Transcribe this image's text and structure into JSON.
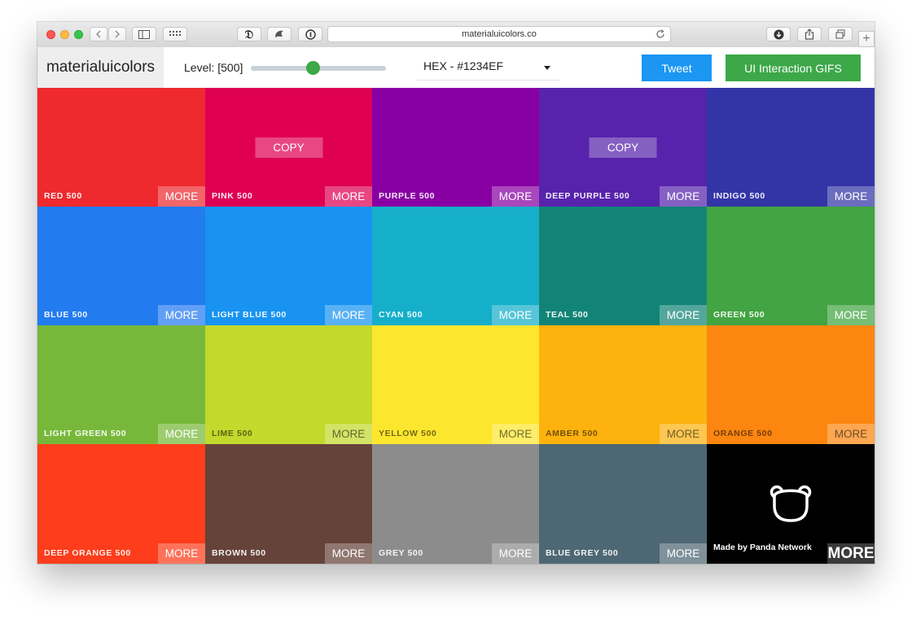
{
  "browser": {
    "url": "materialuicolors.co"
  },
  "header": {
    "logo": "materialuicolors",
    "level_label": "Level: [500]",
    "level_value": 500,
    "format_select": "HEX - #1234EF",
    "tweet_label": "Tweet",
    "gifs_label": "UI Interaction GIFS"
  },
  "actions": {
    "copy_label": "COPY",
    "more_label": "MORE"
  },
  "colors": [
    {
      "name": "RED 500",
      "hex": "#EE2A2E",
      "dark_text": false
    },
    {
      "name": "PINK 500",
      "hex": "#DF0054",
      "dark_text": false
    },
    {
      "name": "PURPLE 500",
      "hex": "#8800A3",
      "dark_text": false
    },
    {
      "name": "DEEP PURPLE 500",
      "hex": "#5723AC",
      "dark_text": false
    },
    {
      "name": "INDIGO 500",
      "hex": "#3335A7",
      "dark_text": false
    },
    {
      "name": "BLUE 500",
      "hex": "#237BF0",
      "dark_text": false
    },
    {
      "name": "LIGHT BLUE 500",
      "hex": "#1893F1",
      "dark_text": false
    },
    {
      "name": "CYAN 500",
      "hex": "#15AFCA",
      "dark_text": false
    },
    {
      "name": "TEAL 500",
      "hex": "#128477",
      "dark_text": false
    },
    {
      "name": "GREEN 500",
      "hex": "#42A442",
      "dark_text": false
    },
    {
      "name": "LIGHT GREEN 500",
      "hex": "#77B83A",
      "dark_text": false
    },
    {
      "name": "LIME 500",
      "hex": "#C3D92C",
      "dark_text": true
    },
    {
      "name": "YELLOW 500",
      "hex": "#FDE72E",
      "dark_text": true
    },
    {
      "name": "AMBER 500",
      "hex": "#FDB20E",
      "dark_text": true
    },
    {
      "name": "ORANGE 500",
      "hex": "#FC8610",
      "dark_text": true
    },
    {
      "name": "DEEP ORANGE 500",
      "hex": "#FD3D1B",
      "dark_text": false
    },
    {
      "name": "BROWN 500",
      "hex": "#66433A",
      "dark_text": false
    },
    {
      "name": "GREY 500",
      "hex": "#8C8C8C",
      "dark_text": false
    },
    {
      "name": "BLUE GREY 500",
      "hex": "#4E6774",
      "dark_text": false
    }
  ],
  "copy_visible_on": [
    "PINK 500",
    "DEEP PURPLE 500"
  ],
  "panda": {
    "text": "Made by Panda Network",
    "more_label": "MORE"
  }
}
